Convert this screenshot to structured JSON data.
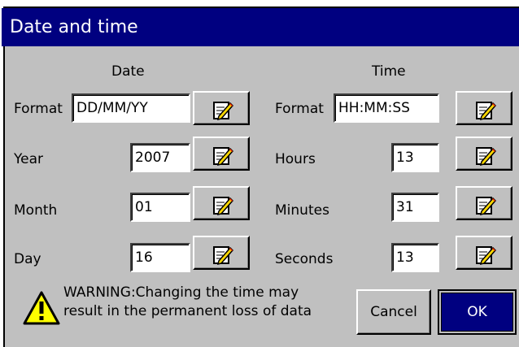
{
  "title": "Date and time",
  "date": {
    "heading": "Date",
    "format_label": "Format",
    "format_value": "DD/MM/YY",
    "year_label": "Year",
    "year_value": "2007",
    "month_label": "Month",
    "month_value": "01",
    "day_label": "Day",
    "day_value": "16"
  },
  "time": {
    "heading": "Time",
    "format_label": "Format",
    "format_value": "HH:MM:SS",
    "hours_label": "Hours",
    "hours_value": "13",
    "minutes_label": "Minutes",
    "minutes_value": "31",
    "seconds_label": "Seconds",
    "seconds_value": "13"
  },
  "warning": {
    "line1": "WARNING:Changing the time may",
    "line2": "result in the permanent loss of data",
    "icon": "warning-icon"
  },
  "buttons": {
    "cancel": "Cancel",
    "ok": "OK"
  },
  "colors": {
    "title_bar": "#000080",
    "dialog": "#c0c0c0",
    "warning": "#ffff00"
  }
}
